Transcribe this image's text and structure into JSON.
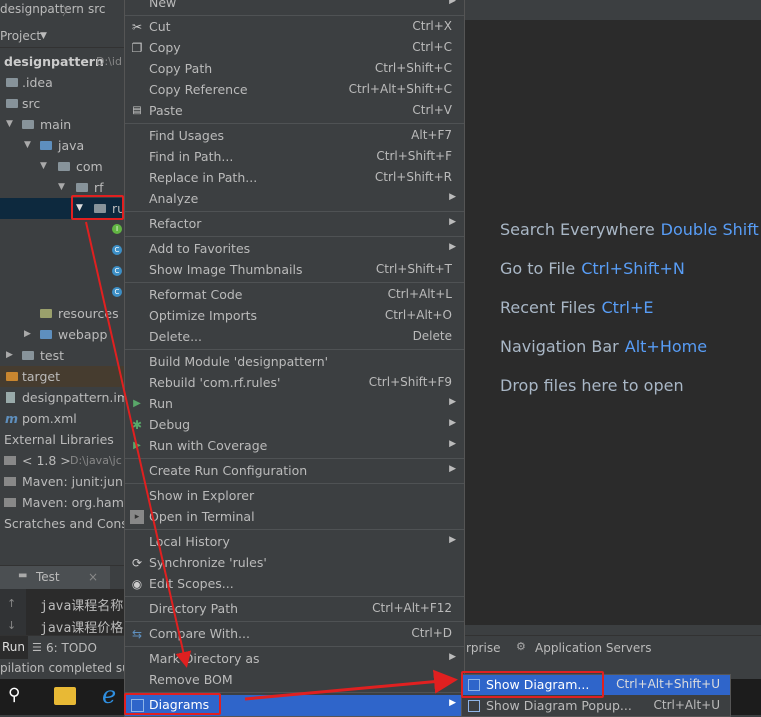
{
  "breadcrumb": {
    "project": "designpattern",
    "sep": "〉",
    "folder": "src"
  },
  "project_panel": {
    "header": "Project",
    "tree": [
      {
        "label": "designpattern",
        "suffix": "D:\\id"
      },
      {
        "label": ".idea"
      },
      {
        "label": "src"
      },
      {
        "label": "main"
      },
      {
        "label": "java"
      },
      {
        "label": "com"
      },
      {
        "label": "rf"
      },
      {
        "label": "ru"
      },
      {
        "label": "resources"
      },
      {
        "label": "webapp"
      },
      {
        "label": "test"
      },
      {
        "label": "target"
      },
      {
        "label": "designpattern.im"
      },
      {
        "label": "pom.xml"
      },
      {
        "label": "External Libraries"
      },
      {
        "label": "< 1.8 >",
        "suffix": "D:\\java\\jc"
      },
      {
        "label": "Maven: junit:junit:"
      },
      {
        "label": "Maven: org.hamc"
      },
      {
        "label": "Scratches and Conso"
      }
    ]
  },
  "editor": {
    "hints": [
      {
        "text": "Search Everywhere",
        "key": "Double Shift"
      },
      {
        "text": "Go to File",
        "key": "Ctrl+Shift+N"
      },
      {
        "text": "Recent Files",
        "key": "Ctrl+E"
      },
      {
        "text": "Navigation Bar",
        "key": "Alt+Home"
      },
      {
        "text": "Drop files here to open",
        "key": ""
      }
    ]
  },
  "run_panel": {
    "tab": "Test",
    "lines": [
      "java课程名称",
      "java课程价格"
    ]
  },
  "tool_windows": {
    "run": "Run",
    "todo": "6: TODO",
    "enterprise": "rprise",
    "app_servers": "Application Servers"
  },
  "status": {
    "text": "pilation completed su"
  },
  "context_menu": {
    "items": [
      {
        "label": "New",
        "shortcut": "",
        "submenu": true
      },
      {
        "label": "Cut",
        "shortcut": "Ctrl+X",
        "icon": "✂"
      },
      {
        "label": "Copy",
        "shortcut": "Ctrl+C",
        "icon": "❐"
      },
      {
        "label": "Copy Path",
        "shortcut": "Ctrl+Shift+C"
      },
      {
        "label": "Copy Reference",
        "shortcut": "Ctrl+Alt+Shift+C"
      },
      {
        "label": "Paste",
        "shortcut": "Ctrl+V",
        "icon": "📋"
      },
      {
        "label": "Find Usages",
        "shortcut": "Alt+F7"
      },
      {
        "label": "Find in Path...",
        "shortcut": "Ctrl+Shift+F"
      },
      {
        "label": "Replace in Path...",
        "shortcut": "Ctrl+Shift+R"
      },
      {
        "label": "Analyze",
        "shortcut": "",
        "submenu": true
      },
      {
        "label": "Refactor",
        "shortcut": "",
        "submenu": true
      },
      {
        "label": "Add to Favorites",
        "shortcut": "",
        "submenu": true
      },
      {
        "label": "Show Image Thumbnails",
        "shortcut": "Ctrl+Shift+T"
      },
      {
        "label": "Reformat Code",
        "shortcut": "Ctrl+Alt+L"
      },
      {
        "label": "Optimize Imports",
        "shortcut": "Ctrl+Alt+O"
      },
      {
        "label": "Delete...",
        "shortcut": "Delete"
      },
      {
        "label": "Build Module 'designpattern'",
        "shortcut": ""
      },
      {
        "label": "Rebuild 'com.rf.rules'",
        "shortcut": "Ctrl+Shift+F9"
      },
      {
        "label": "Run",
        "shortcut": "",
        "submenu": true
      },
      {
        "label": "Debug",
        "shortcut": "",
        "submenu": true
      },
      {
        "label": "Run with Coverage",
        "shortcut": "",
        "submenu": true
      },
      {
        "label": "Create Run Configuration",
        "shortcut": "",
        "submenu": true
      },
      {
        "label": "Show in Explorer",
        "shortcut": ""
      },
      {
        "label": "Open in Terminal",
        "shortcut": ""
      },
      {
        "label": "Local History",
        "shortcut": "",
        "submenu": true
      },
      {
        "label": "Synchronize 'rules'",
        "shortcut": ""
      },
      {
        "label": "Edit Scopes...",
        "shortcut": ""
      },
      {
        "label": "Directory Path",
        "shortcut": "Ctrl+Alt+F12"
      },
      {
        "label": "Compare With...",
        "shortcut": "Ctrl+D"
      },
      {
        "label": "Mark Directory as",
        "shortcut": "",
        "submenu": true
      },
      {
        "label": "Remove BOM",
        "shortcut": ""
      },
      {
        "label": "Diagrams",
        "shortcut": "",
        "submenu": true
      }
    ]
  },
  "submenu": {
    "items": [
      {
        "label": "Show Diagram...",
        "shortcut": "Ctrl+Alt+Shift+U"
      },
      {
        "label": "Show Diagram Popup...",
        "shortcut": "Ctrl+Alt+U"
      }
    ]
  },
  "colors": {
    "selection": "#2f65ca",
    "annotation": "#e02020",
    "shortcut_key": "#589df6"
  }
}
